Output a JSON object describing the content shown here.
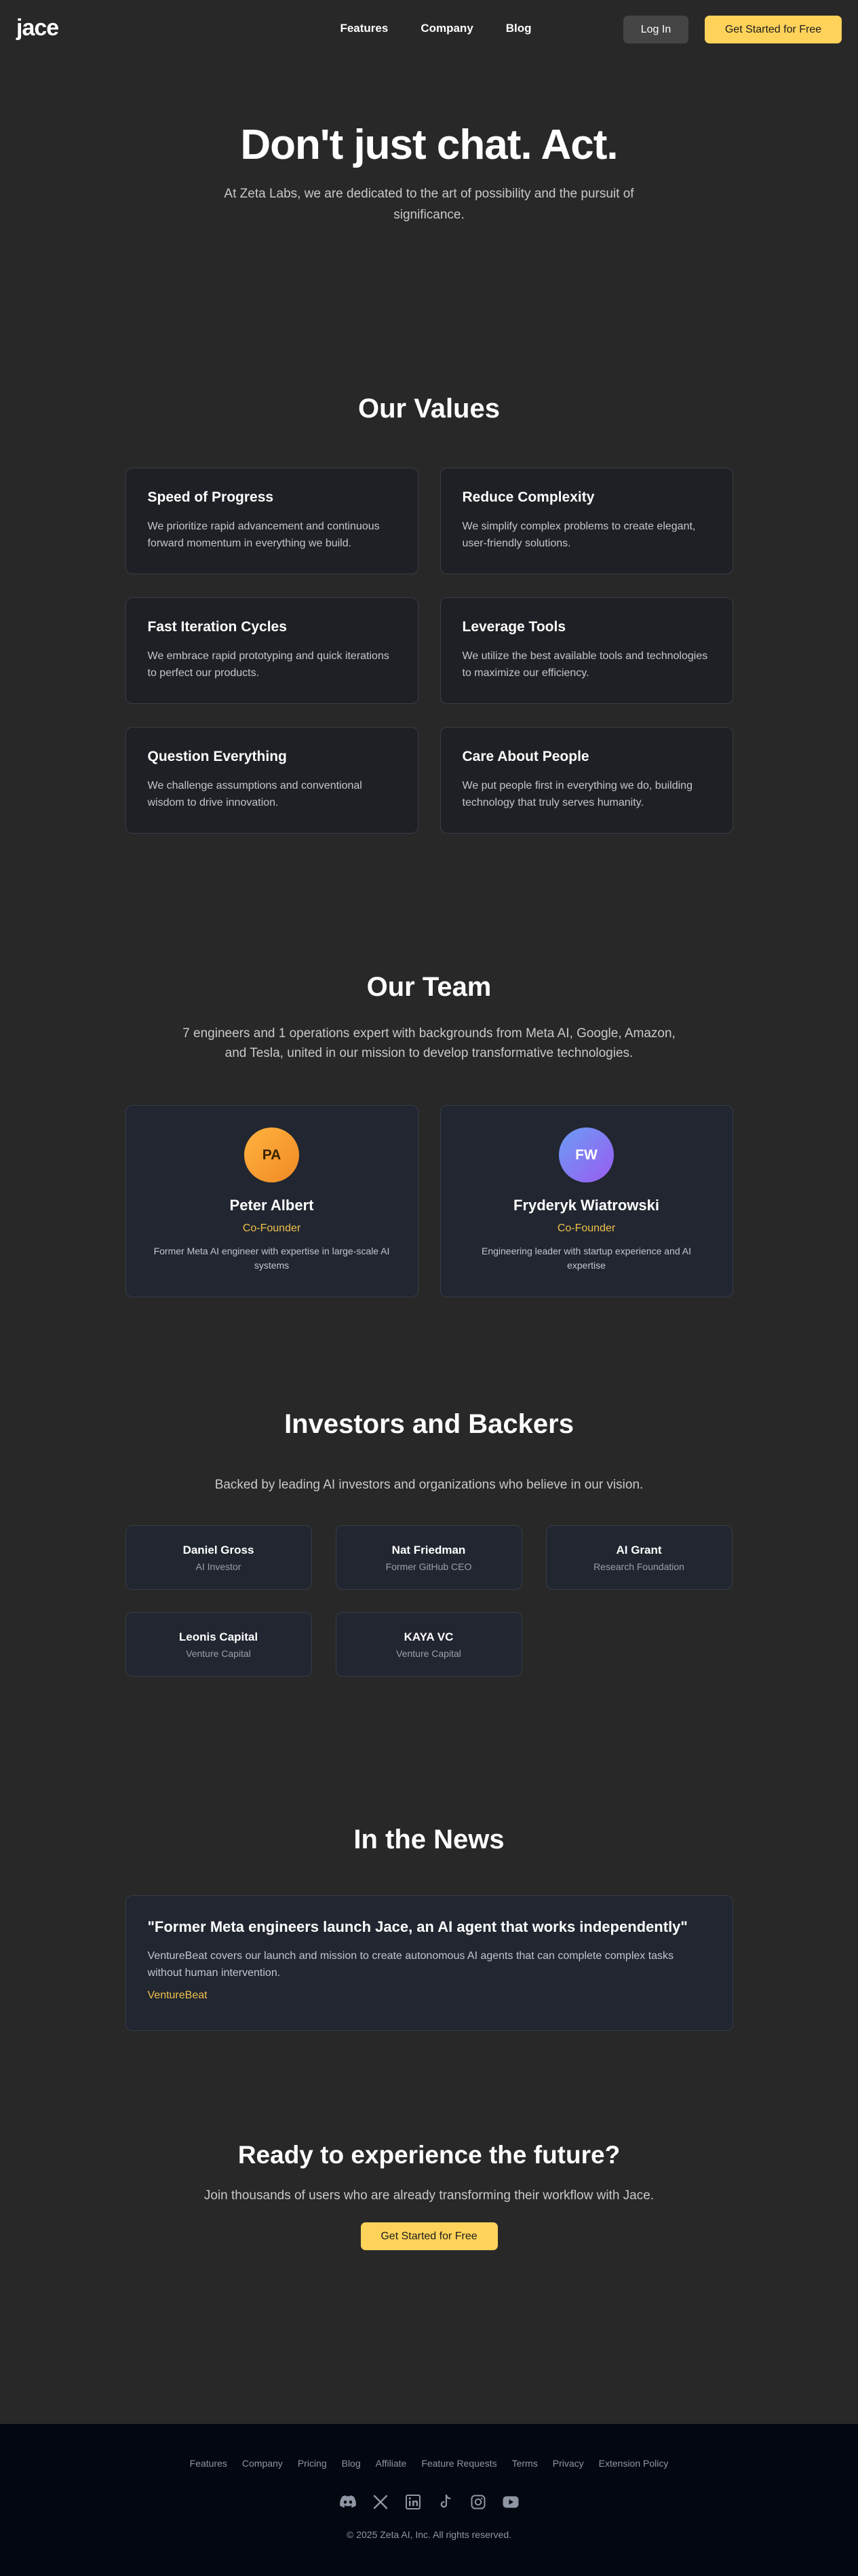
{
  "nav": {
    "logo": "jace",
    "links": [
      "Features",
      "Company",
      "Blog"
    ],
    "login": "Log In",
    "cta": "Get Started for Free"
  },
  "hero": {
    "title": "Don't just chat. Act.",
    "subtitle": "At Zeta Labs, we are dedicated to the art of possibility and the pursuit of significance."
  },
  "values": {
    "title": "Our Values",
    "items": [
      {
        "title": "Speed of Progress",
        "text": "We prioritize rapid advancement and continuous forward momentum in everything we build."
      },
      {
        "title": "Reduce Complexity",
        "text": "We simplify complex problems to create elegant, user-friendly solutions."
      },
      {
        "title": "Fast Iteration Cycles",
        "text": "We embrace rapid prototyping and quick iterations to perfect our products."
      },
      {
        "title": "Leverage Tools",
        "text": "We utilize the best available tools and technologies to maximize our efficiency."
      },
      {
        "title": "Question Everything",
        "text": "We challenge assumptions and conventional wisdom to drive innovation."
      },
      {
        "title": "Care About People",
        "text": "We put people first in everything we do, building technology that truly serves humanity."
      }
    ]
  },
  "team": {
    "title": "Our Team",
    "lead": "7 engineers and 1 operations expert with backgrounds from Meta AI, Google, Amazon, and Tesla, united in our mission to develop transformative technologies.",
    "members": [
      {
        "initials": "PA",
        "name": "Peter Albert",
        "role": "Co-Founder",
        "bio": "Former Meta AI engineer with expertise in large-scale AI systems"
      },
      {
        "initials": "FW",
        "name": "Fryderyk Wiatrowski",
        "role": "Co-Founder",
        "bio": "Engineering leader with startup experience and AI expertise"
      }
    ]
  },
  "investors": {
    "title": "Investors and Backers",
    "lead": "Backed by leading AI investors and organizations who believe in our vision.",
    "items": [
      {
        "name": "Daniel Gross",
        "desc": "AI Investor"
      },
      {
        "name": "Nat Friedman",
        "desc": "Former GitHub CEO"
      },
      {
        "name": "AI Grant",
        "desc": "Research Foundation"
      },
      {
        "name": "Leonis Capital",
        "desc": "Venture Capital"
      },
      {
        "name": "KAYA VC",
        "desc": "Venture Capital"
      }
    ]
  },
  "news": {
    "title": "In the News",
    "headline": "\"Former Meta engineers launch Jace, an AI agent that works independently\"",
    "summary": "VentureBeat covers our launch and mission to create autonomous AI agents that can complete complex tasks without human intervention.",
    "source": "VentureBeat"
  },
  "cta": {
    "title": "Ready to experience the future?",
    "text": "Join thousands of users who are already transforming their workflow with Jace.",
    "button": "Get Started for Free"
  },
  "footer": {
    "links": [
      "Features",
      "Company",
      "Pricing",
      "Blog",
      "Affiliate",
      "Feature Requests",
      "Terms",
      "Privacy",
      "Extension Policy"
    ],
    "socials": [
      "discord-icon",
      "x-icon",
      "linkedin-icon",
      "tiktok-icon",
      "instagram-icon",
      "youtube-icon"
    ],
    "copyright": "© 2025 Zeta AI, Inc. All rights reserved."
  },
  "colors": {
    "background": "#282828",
    "accent": "#ffd35a",
    "role": "#f0c14b",
    "footer": "#03070f"
  }
}
